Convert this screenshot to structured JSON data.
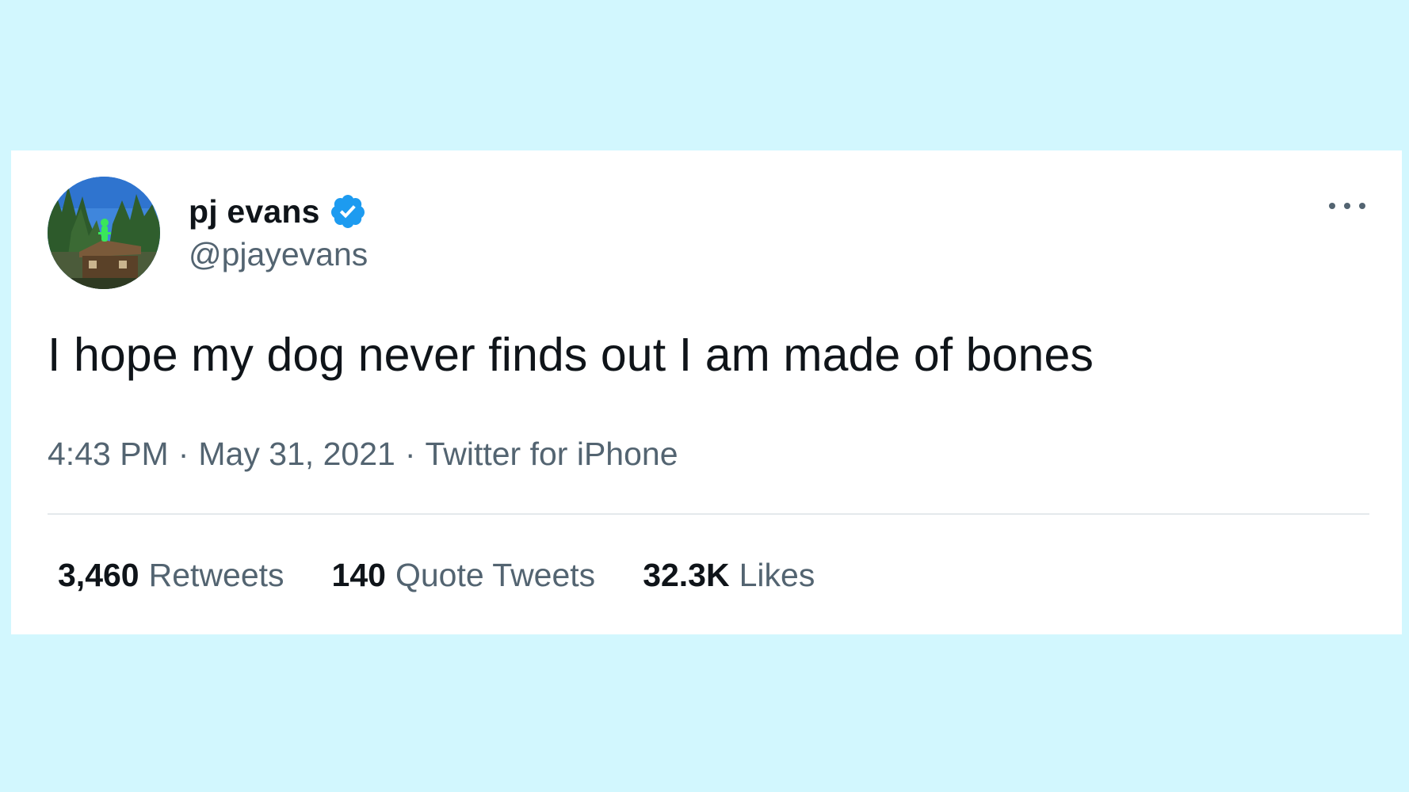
{
  "tweet": {
    "display_name": "pj evans",
    "handle": "@pjayevans",
    "verified": true,
    "text": "I hope my dog never finds out I am made of bones",
    "time": "4:43 PM",
    "separator": "·",
    "date": "May 31, 2021",
    "source": "Twitter for iPhone",
    "stats": [
      {
        "count": "3,460",
        "label": "Retweets"
      },
      {
        "count": "140",
        "label": "Quote Tweets"
      },
      {
        "count": "32.3K",
        "label": "Likes"
      }
    ]
  },
  "icons": {
    "verified": "verified-badge-icon",
    "more": "more-options-icon"
  },
  "colors": {
    "background": "#d2f7fe",
    "card": "#ffffff",
    "primary_text": "#0f1419",
    "secondary_text": "#536471",
    "verified_blue": "#1d9bf0",
    "divider": "#e4e9ec"
  }
}
